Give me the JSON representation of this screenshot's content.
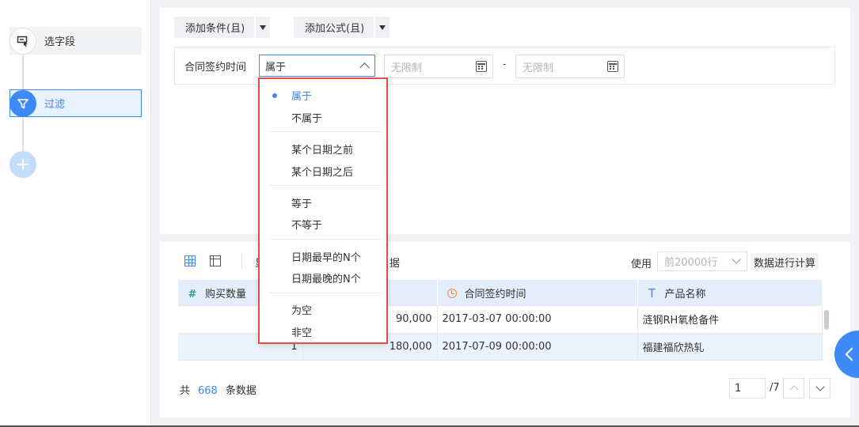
{
  "steps": {
    "select_fields": "选字段",
    "filter": "过滤"
  },
  "toolbar": {
    "add_condition": "添加条件(且)",
    "add_formula": "添加公式(且)"
  },
  "condition": {
    "field_label": "合同签约时间",
    "operator": "属于",
    "start_placeholder": "无限制",
    "end_placeholder": "无限制",
    "range_separator": "-"
  },
  "dropdown": {
    "items": [
      "属于",
      "不属于",
      "某个日期之前",
      "某个日期之后",
      "等于",
      "不等于",
      "日期最早的N个",
      "日期最晚的N个",
      "为空",
      "非空"
    ]
  },
  "data_toolbar": {
    "partial_left": "显",
    "partial_right": "据",
    "use_label": "使用",
    "rows_placeholder": "前20000行",
    "calc_label": "数据进行计算"
  },
  "table": {
    "headers": [
      "购买数量",
      "",
      "合同签约时间",
      "产品名称"
    ],
    "rows": [
      [
        "",
        "90,000",
        "2017-03-07 00:00:00",
        "涟钢RH氧枪备件"
      ],
      [
        "1",
        "180,000",
        "2017-07-09 00:00:00",
        "福建福欣热轧"
      ]
    ]
  },
  "footer": {
    "total_prefix": "共",
    "total_count": "668",
    "total_suffix": "条数据",
    "current_page": "1",
    "total_pages": "/7"
  },
  "colors": {
    "accent": "#3d8af7",
    "highlight_border": "#e44b4b"
  }
}
